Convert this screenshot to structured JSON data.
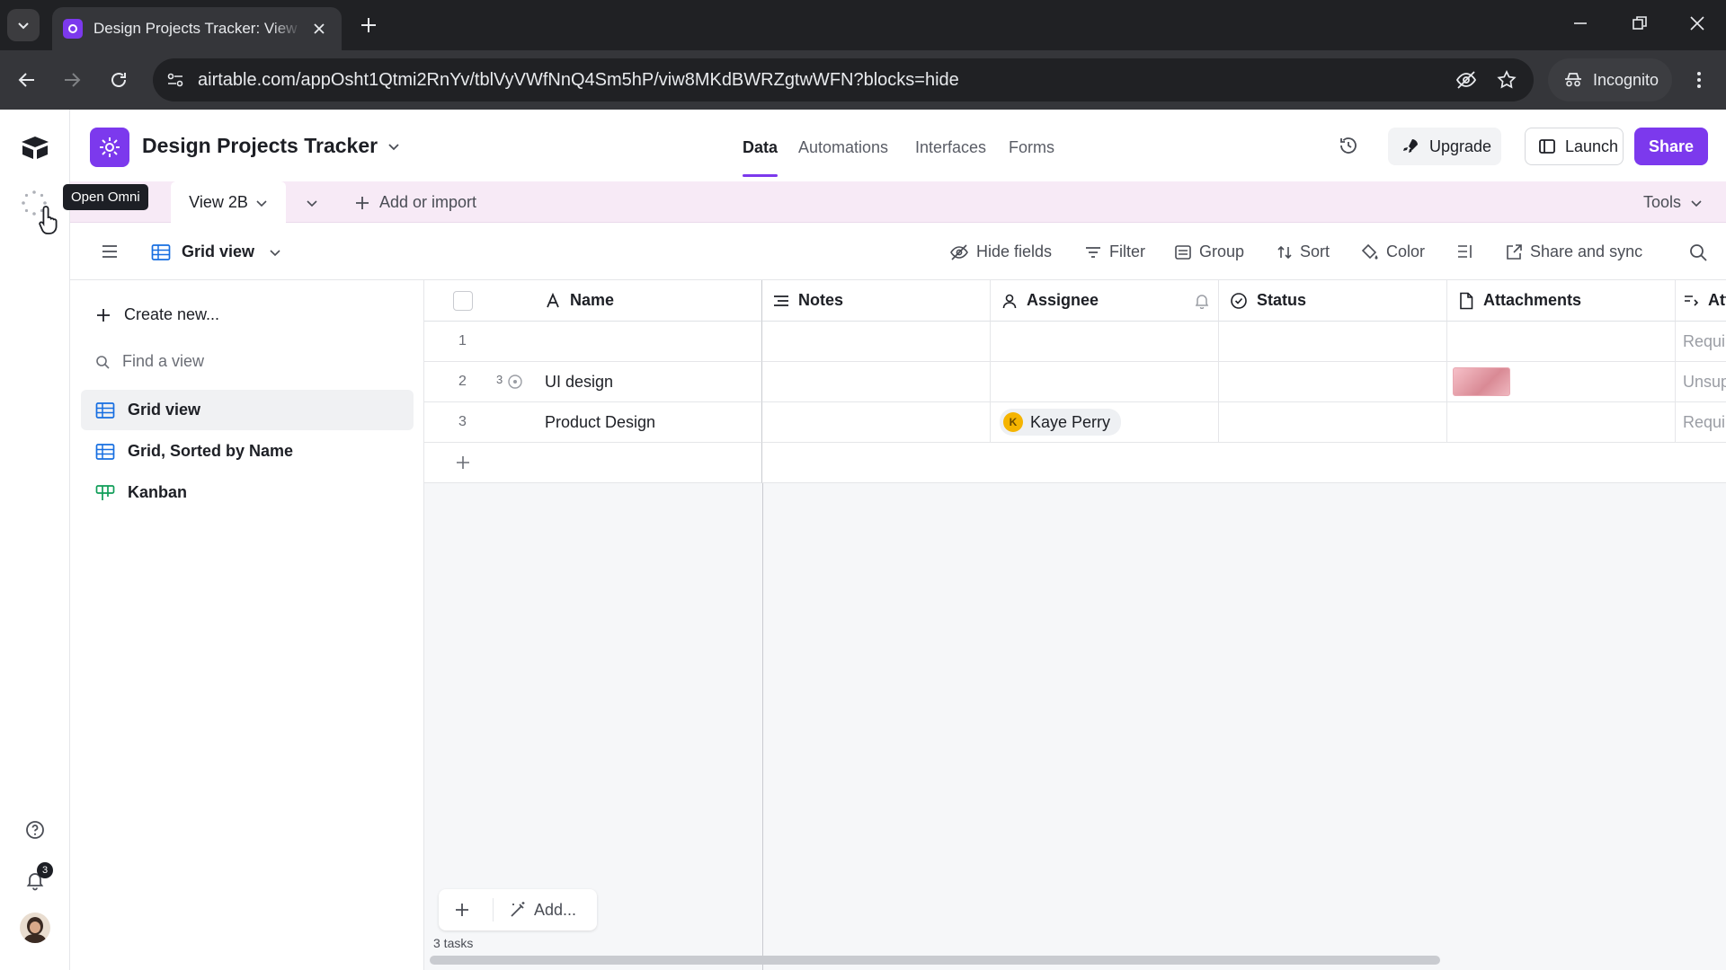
{
  "browser": {
    "tab_title": "Design Projects Tracker: View 2B",
    "url": "airtable.com/appOsht1Qtmi2RnYv/tblVyVWfNnQ4Sm5hP/viw8MKdBWRZgtwWFN?blocks=hide",
    "incognito_label": "Incognito"
  },
  "app": {
    "base_title": "Design Projects Tracker",
    "nav_tabs": [
      "Data",
      "Automations",
      "Interfaces",
      "Forms"
    ],
    "upgrade_label": "Upgrade",
    "launch_label": "Launch",
    "share_label": "Share",
    "accent_color": "#7c39ed"
  },
  "viewbar": {
    "view_tab": "View 2B",
    "add_import": "Add or import",
    "tools": "Tools",
    "tooltip": "Open Omni"
  },
  "viewtools": {
    "view_name": "Grid view",
    "hide_fields": "Hide fields",
    "filter": "Filter",
    "group": "Group",
    "sort": "Sort",
    "color": "Color",
    "share_sync": "Share and sync"
  },
  "sidebar": {
    "create_new": "Create new...",
    "find_placeholder": "Find a view",
    "views": [
      "Grid view",
      "Grid, Sorted by Name",
      "Kanban"
    ]
  },
  "grid": {
    "columns": [
      "Name",
      "Notes",
      "Assignee",
      "Status",
      "Attachments",
      "Att"
    ],
    "rows": [
      {
        "num": "1",
        "name": "",
        "comments": "",
        "assignee": "",
        "assignee_initial": "",
        "last": "Requir"
      },
      {
        "num": "2",
        "name": "UI design",
        "comments": "3",
        "assignee": "",
        "assignee_initial": "",
        "last": "Unsup"
      },
      {
        "num": "3",
        "name": "Product Design",
        "comments": "",
        "assignee": "Kaye Perry",
        "assignee_initial": "K",
        "last": "Requir"
      }
    ],
    "add_label": "Add...",
    "record_count": "3 tasks"
  },
  "notifications": {
    "badge": "3"
  }
}
